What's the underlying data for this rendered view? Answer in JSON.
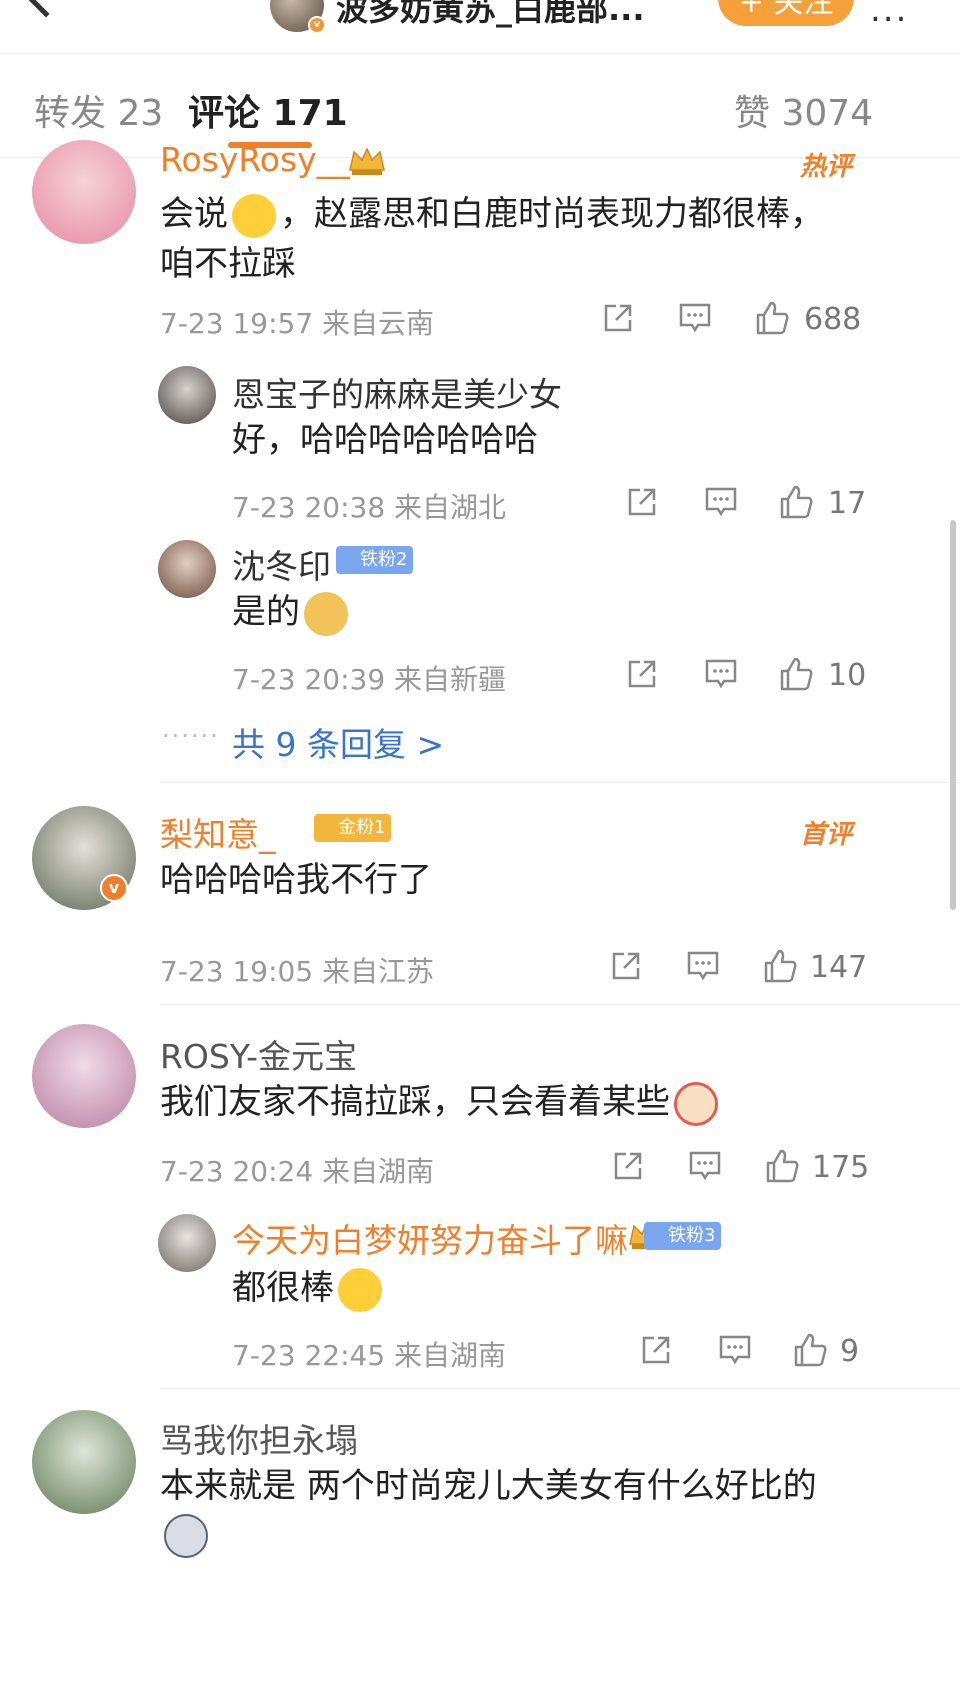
{
  "header": {
    "title": "波多妨黄苏_白鹿部...",
    "follow_label": "+ 关注",
    "more_label": "..."
  },
  "tabs": [
    {
      "label": "转发 23"
    },
    {
      "label": "评论 171"
    },
    {
      "label": "赞 3074"
    }
  ],
  "comments": [
    {
      "user": "RosyRosy__",
      "tag": "热评",
      "text_lines": [
        "会说",
        "，赵露思和白鹿时尚表现力都很棒，",
        "咱不拉踩"
      ],
      "meta": "7-23 19:57  来自云南",
      "likes": "688",
      "replies": [
        {
          "user": "恩宝子的麻麻是美少女",
          "text": "好，哈哈哈哈哈哈哈",
          "meta": "7-23 20:38  来自湖北",
          "likes": "17"
        },
        {
          "user": "沈冬印",
          "badge": "铁粉2",
          "text": "是的",
          "meta": "7-23 20:39  来自新疆",
          "likes": "10"
        }
      ],
      "more_replies": "共 9 条回复 >"
    },
    {
      "user": "梨知意_",
      "badge": "金粉1",
      "tag": "首评",
      "text": "哈哈哈哈我不行了",
      "meta": "7-23 19:05  来自江苏",
      "likes": "147"
    },
    {
      "user": "ROSY-金元宝",
      "text": "我们友家不搞拉踩，只会看着某些",
      "meta": "7-23 20:24  来自湖南",
      "likes": "175",
      "replies": [
        {
          "user": "今天为白梦妍努力奋斗了嘛",
          "badge": "铁粉3",
          "text": "都很棒",
          "meta": "7-23 22:45  来自湖南",
          "likes": "9"
        }
      ]
    },
    {
      "user": "骂我你担永塌",
      "text": "本来就是 两个时尚宠儿大美女有什么好比的"
    }
  ],
  "colors": {
    "accent": "#f07f2a",
    "link": "#3a73c8",
    "meta": "#999999"
  }
}
